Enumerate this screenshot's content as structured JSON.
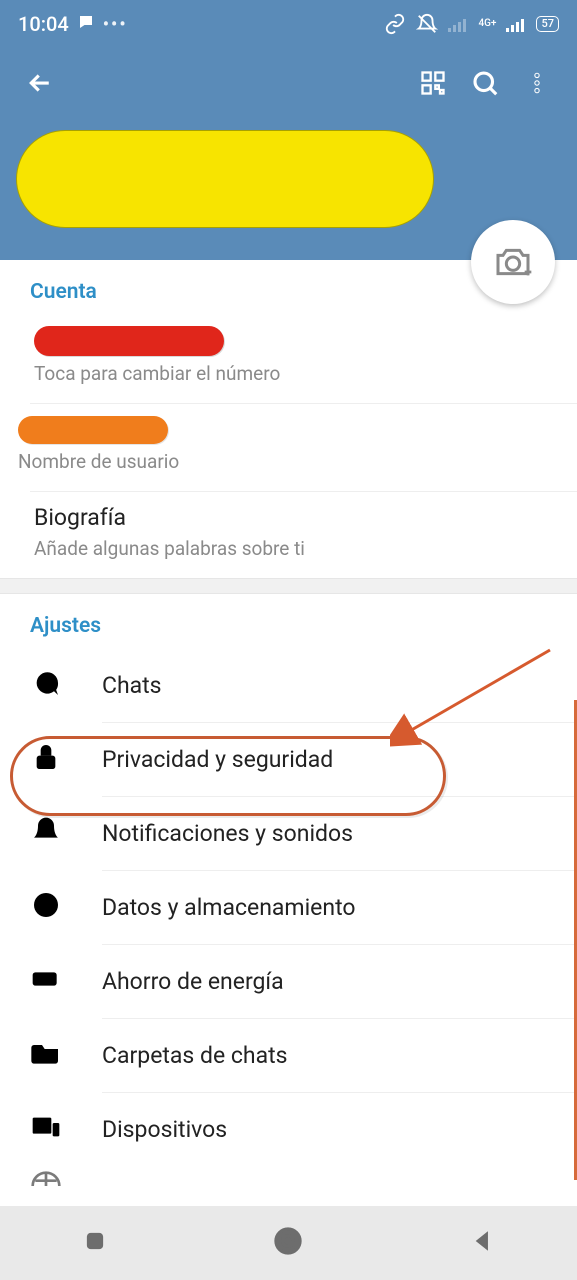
{
  "status": {
    "time": "10:04",
    "network_label": "4G+",
    "battery_text": "57"
  },
  "account": {
    "section_title": "Cuenta",
    "phone_subtitle": "Toca para cambiar el número",
    "username_subtitle": "Nombre de usuario",
    "bio_label": "Biografía",
    "bio_subtitle": "Añade algunas palabras sobre ti"
  },
  "settings": {
    "section_title": "Ajustes",
    "items": [
      {
        "label": "Chats"
      },
      {
        "label": "Privacidad y seguridad"
      },
      {
        "label": "Notificaciones y sonidos"
      },
      {
        "label": "Datos y almacenamiento"
      },
      {
        "label": "Ahorro de energía"
      },
      {
        "label": "Carpetas de chats"
      },
      {
        "label": "Dispositivos"
      }
    ]
  }
}
